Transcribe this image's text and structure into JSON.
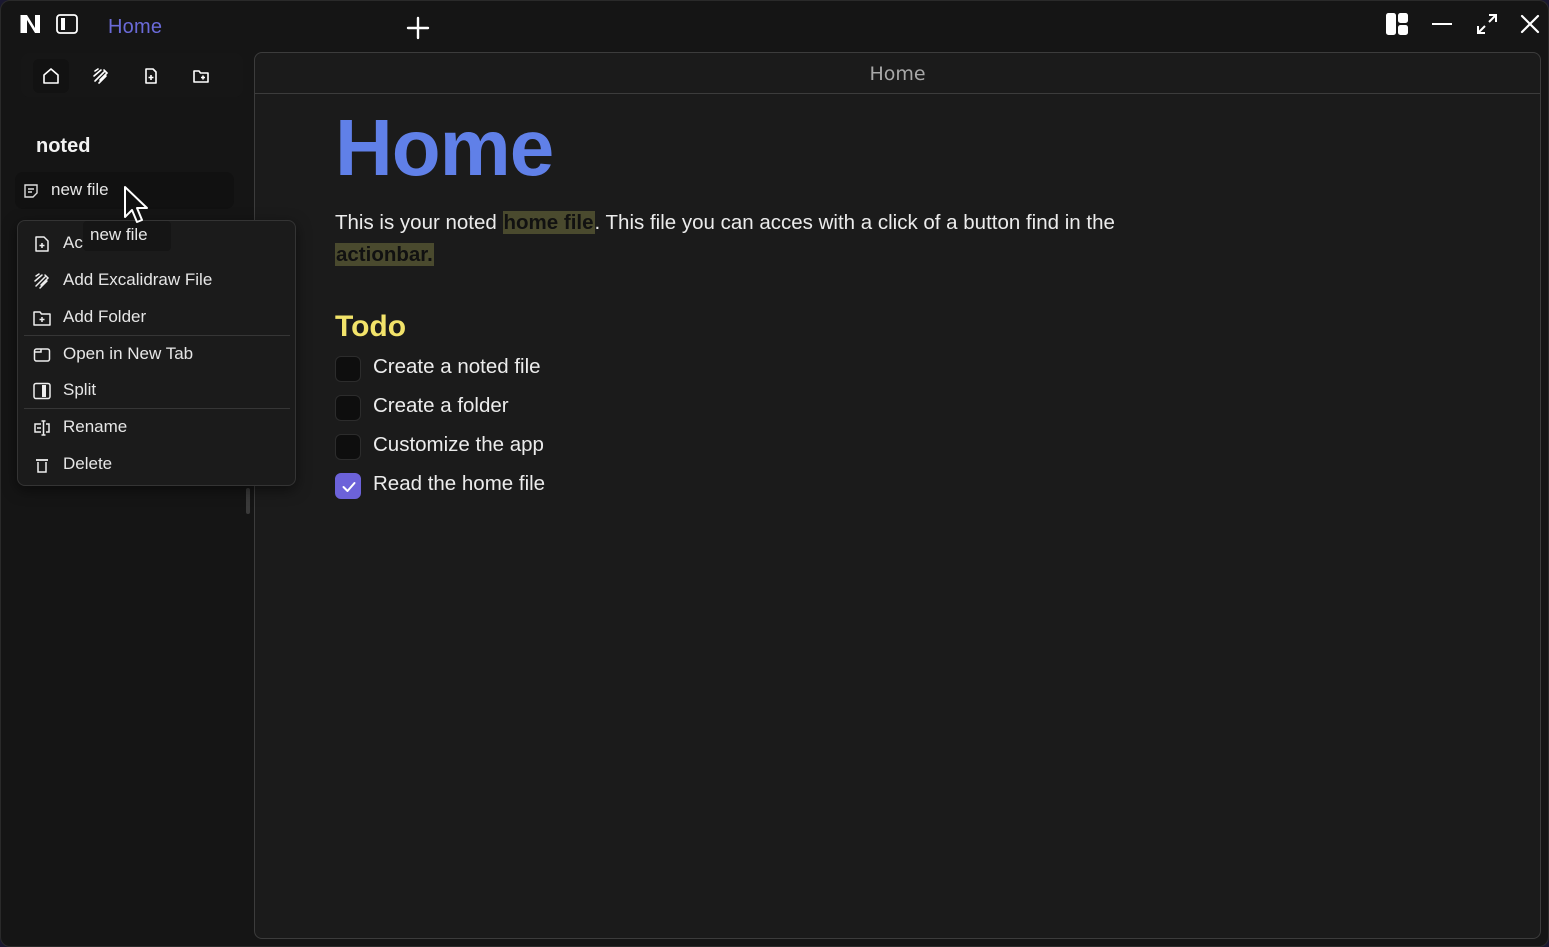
{
  "titlebar": {
    "active_tab": "Home",
    "icons": [
      "noted-logo-icon",
      "sidebar-toggle-icon",
      "plus-icon",
      "layout-icon",
      "minimize-icon",
      "maximize-icon",
      "close-icon"
    ]
  },
  "sidebar": {
    "action_bar": [
      "home-icon",
      "excalidraw-icon",
      "new-file-icon",
      "new-folder-icon"
    ],
    "vault_name": "noted",
    "files": [
      {
        "label": "new file",
        "icon": "note-icon"
      }
    ],
    "drag_ghost_label": "new file"
  },
  "context_menu": {
    "items": [
      {
        "label": "Add File",
        "visible_label": "Ac",
        "icon": "file-plus-icon"
      },
      {
        "label": "Add Excalidraw File",
        "icon": "excalidraw-icon"
      },
      {
        "label": "Add Folder",
        "icon": "folder-plus-icon"
      },
      {
        "label": "Open in New Tab",
        "icon": "window-icon"
      },
      {
        "label": "Split",
        "icon": "split-icon"
      },
      {
        "label": "Rename",
        "icon": "rename-icon"
      },
      {
        "label": "Delete",
        "icon": "trash-icon"
      }
    ]
  },
  "pane": {
    "title": "Home",
    "doc": {
      "heading": "Home",
      "para_1": "This is your noted ",
      "highlight_1": "home file",
      "para_2": ". This file you can acces with a click of a button find in the ",
      "highlight_2": "actionbar.",
      "todo_heading": "Todo",
      "todos": [
        {
          "label": "Create a noted file",
          "checked": false
        },
        {
          "label": "Create a folder",
          "checked": false
        },
        {
          "label": "Customize the app",
          "checked": false
        },
        {
          "label": "Read the home file",
          "checked": true
        }
      ]
    }
  },
  "colors": {
    "accent": "#6c62d9",
    "heading_blue": "#6080e8",
    "todo_yellow": "#f2e36a",
    "tab_active": "#6a6ad8",
    "highlight_bg": "#4a4a2e"
  }
}
